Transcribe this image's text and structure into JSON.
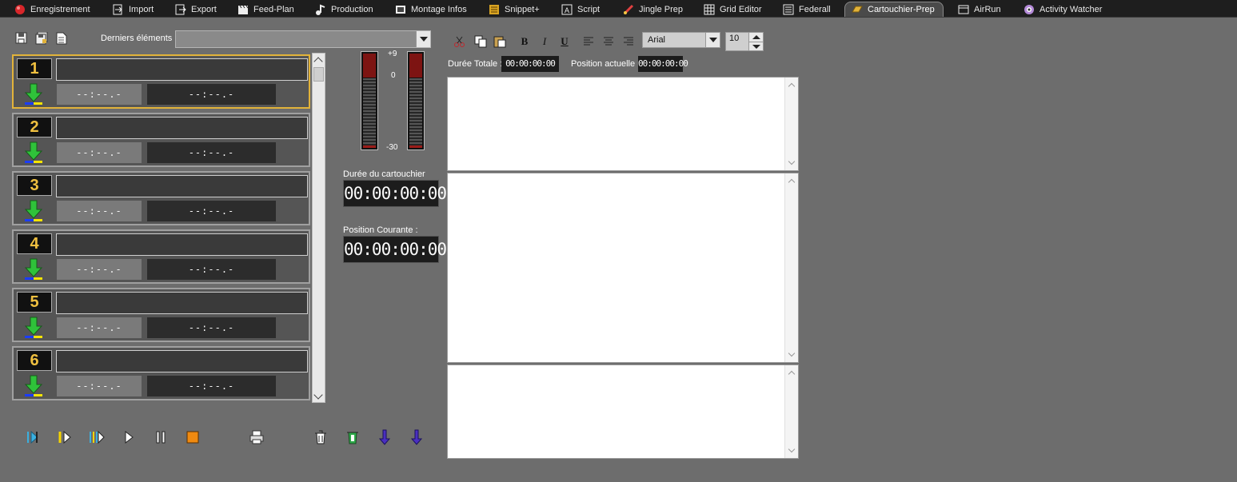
{
  "tabs": [
    {
      "label": "Enregistrement",
      "icon": "record-icon"
    },
    {
      "label": "Import",
      "icon": "import-icon"
    },
    {
      "label": "Export",
      "icon": "export-icon"
    },
    {
      "label": "Feed-Plan",
      "icon": "clapper-icon"
    },
    {
      "label": "Production",
      "icon": "music-note-icon"
    },
    {
      "label": "Montage Infos",
      "icon": "film-icon"
    },
    {
      "label": "Snippet+",
      "icon": "snippet-icon"
    },
    {
      "label": "Script",
      "icon": "script-icon"
    },
    {
      "label": "Jingle Prep",
      "icon": "jingle-icon"
    },
    {
      "label": "Grid Editor",
      "icon": "grid-icon"
    },
    {
      "label": "Federall",
      "icon": "list-icon"
    },
    {
      "label": "Cartouchier-Prep",
      "icon": "cartridge-icon",
      "active": true
    },
    {
      "label": "AirRun",
      "icon": "airrun-icon"
    },
    {
      "label": "Activity Watcher",
      "icon": "watcher-icon"
    }
  ],
  "toolbar": {
    "recent_label": "Derniers éléments :",
    "recent_value": ""
  },
  "carts": [
    {
      "number": "1",
      "title": "",
      "time_left": "--:--.-",
      "time_right": "--:--.-",
      "selected": true
    },
    {
      "number": "2",
      "title": "",
      "time_left": "--:--.-",
      "time_right": "--:--.-"
    },
    {
      "number": "3",
      "title": "",
      "time_left": "--:--.-",
      "time_right": "--:--.-"
    },
    {
      "number": "4",
      "title": "",
      "time_left": "--:--.-",
      "time_right": "--:--.-"
    },
    {
      "number": "5",
      "title": "",
      "time_left": "--:--.-",
      "time_right": "--:--.-"
    },
    {
      "number": "6",
      "title": "",
      "time_left": "--:--.-",
      "time_right": "--:--.-"
    }
  ],
  "vu": {
    "scale_top": "+9",
    "scale_mid": "0",
    "scale_bottom": "-30"
  },
  "cart_duration": {
    "label": "Durée du cartouchier",
    "value": "00:00:00:00"
  },
  "current_position": {
    "label": "Position Courante :",
    "value": "00:00:00:00"
  },
  "editor": {
    "font": "Arial",
    "size": "10",
    "total_duration_label": "Durée Totale :",
    "total_duration": "00:00:00:00",
    "position_label": "Position actuelle :",
    "position": "00:00:00:00",
    "text1": "",
    "text2": "",
    "text3": ""
  },
  "colors": {
    "accent": "#e2b33a",
    "background": "#6d6d6d",
    "tabbar": "#1e1e1e"
  }
}
